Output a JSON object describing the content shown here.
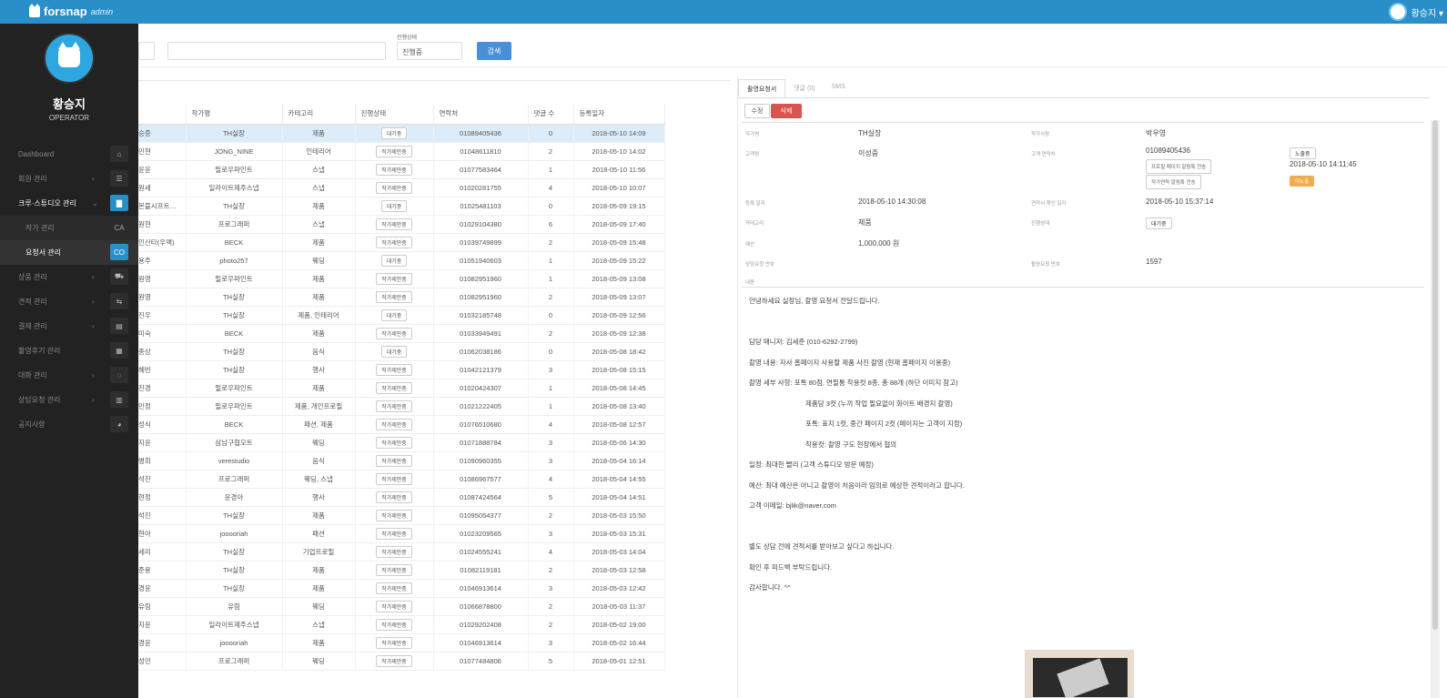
{
  "topbar": {
    "brand": "forsnap",
    "brand_suffix": "admin",
    "user_name": "황승지 ▾"
  },
  "sidebar": {
    "name": "황승지",
    "role": "OPERATOR",
    "menu": [
      {
        "label": "Dashboard",
        "icon": "home-icon",
        "badge": "⌂",
        "chevron": ""
      },
      {
        "label": "회원 관리",
        "icon": "user-icon",
        "badge": "☰",
        "chevron": "›"
      },
      {
        "label": "크루·스튜디오 관리",
        "icon": "book-icon",
        "badge": "▇",
        "chevron": "⌄"
      },
      {
        "label": "작가 관리",
        "icon": "ca-icon",
        "badge": "CA",
        "chevron": ""
      },
      {
        "label": "요청서 관리",
        "icon": "co-icon",
        "badge": "CO",
        "chevron": ""
      },
      {
        "label": "상품 관리",
        "icon": "product-icon",
        "badge": "⛟",
        "chevron": "›"
      },
      {
        "label": "견적 관리",
        "icon": "estimate-icon",
        "badge": "⇆",
        "chevron": "›"
      },
      {
        "label": "결제 관리",
        "icon": "payment-icon",
        "badge": "▤",
        "chevron": "›"
      },
      {
        "label": "촬영후기 관리",
        "icon": "review-icon",
        "badge": "▦",
        "chevron": ""
      },
      {
        "label": "대화 관리",
        "icon": "chat-icon",
        "badge": "◌",
        "chevron": "›"
      },
      {
        "label": "상담요청 관리",
        "icon": "consult-icon",
        "badge": "▥",
        "chevron": "›"
      },
      {
        "label": "공지사항",
        "icon": "notice-icon",
        "badge": "◕",
        "chevron": ""
      }
    ]
  },
  "filters": {
    "status_label": "진행상태",
    "status_value": "진행중",
    "search_button": "검색"
  },
  "table": {
    "headers": [
      "",
      "작가명",
      "카테고리",
      "진행상태",
      "연락처",
      "댓글 수",
      "등록일자"
    ],
    "rows": [
      [
        "승증",
        "TH실장",
        "제품",
        "대기중",
        "01089405436",
        "0",
        "2018-05-10 14:09"
      ],
      [
        "민현",
        "JONG_NINE",
        "인테리어",
        "작가제안중",
        "01048611810",
        "2",
        "2018-05-10 14:02"
      ],
      [
        "윤윤",
        "필로우파인트",
        "스냅",
        "작가제안중",
        "01077583464",
        "1",
        "2018-05-10 11:56"
      ],
      [
        "원세",
        "일라이트제주스냅",
        "스냅",
        "작가제안중",
        "01020281755",
        "4",
        "2018-05-10 10:07"
      ],
      [
        "몬블시프트…",
        "TH실장",
        "제품",
        "대기중",
        "01025481103",
        "0",
        "2018-05-09 19:15"
      ],
      [
        "원현",
        "프로그래퍼",
        "스냅",
        "작가제안중",
        "01029104380",
        "6",
        "2018-05-09 17:40"
      ],
      [
        "인산타(우맥)",
        "BECK",
        "제품",
        "작가제안중",
        "01039749899",
        "2",
        "2018-05-09 15:48"
      ],
      [
        "용주",
        "photo257",
        "웨딩",
        "대기중",
        "01051940603",
        "1",
        "2018-05-09 15:22"
      ],
      [
        "원영",
        "필로우파인트",
        "제품",
        "작가제안중",
        "01082951960",
        "1",
        "2018-05-09 13:08"
      ],
      [
        "원영",
        "TH실장",
        "제품",
        "작가제안중",
        "01082951960",
        "2",
        "2018-05-09 13:07"
      ],
      [
        "진우",
        "TH실장",
        "제품, 인테리어",
        "대기중",
        "01032185748",
        "0",
        "2018-05-09 12:56"
      ],
      [
        "미숙",
        "BECK",
        "제품",
        "작가제안중",
        "01033949491",
        "2",
        "2018-05-09 12:38"
      ],
      [
        "종상",
        "TH실장",
        "음식",
        "대기중",
        "01062038186",
        "0",
        "2018-05-08 18:42"
      ],
      [
        "혜빈",
        "TH실장",
        "행사",
        "작가제안중",
        "01042121379",
        "3",
        "2018-05-08 15:15"
      ],
      [
        "진경",
        "필로우파인트",
        "제품",
        "작가제안중",
        "01020424307",
        "1",
        "2018-05-08 14:45"
      ],
      [
        "민정",
        "필로우파인트",
        "제품, 개인프로필",
        "작가제안중",
        "01021222405",
        "1",
        "2018-05-08 13:40"
      ],
      [
        "성식",
        "BECK",
        "패션, 제품",
        "작가제안중",
        "01076510680",
        "4",
        "2018-05-08 12:57"
      ],
      [
        "지윤",
        "삼남구협모트",
        "웨딩",
        "작가제안중",
        "01071888784",
        "3",
        "2018-05-06 14:30"
      ],
      [
        "병희",
        "verestudio",
        "음식",
        "작가제안중",
        "01090960355",
        "3",
        "2018-05-04 16:14"
      ],
      [
        "석진",
        "프로그래퍼",
        "웨딩, 스냅",
        "작가제안중",
        "01086967577",
        "4",
        "2018-05-04 14:55"
      ],
      [
        "현정",
        "윤경아",
        "행사",
        "작가제안중",
        "01087424564",
        "5",
        "2018-05-04 14:51"
      ],
      [
        "석진",
        "TH실장",
        "제품",
        "작가제안중",
        "01095054377",
        "2",
        "2018-05-03 15:50"
      ],
      [
        "현아",
        "jooooriah",
        "패션",
        "작가제안중",
        "01023209565",
        "3",
        "2018-05-03 15:31"
      ],
      [
        "세리",
        "TH실장",
        "기업프로필",
        "작가제안중",
        "01024555241",
        "4",
        "2018-05-03 14:04"
      ],
      [
        "준용",
        "TH실장",
        "제품",
        "작가제안중",
        "01082119181",
        "2",
        "2018-05-03 12:58"
      ],
      [
        "경윤",
        "TH실장",
        "제품",
        "작가제안중",
        "01046913614",
        "3",
        "2018-05-03 12:42"
      ],
      [
        "유림",
        "유림",
        "웨딩",
        "작가제안중",
        "01066878800",
        "2",
        "2018-05-03 11:37"
      ],
      [
        "지윤",
        "일라이트제주스냅",
        "스냅",
        "작가제안중",
        "01029202408",
        "2",
        "2018-05-02 19:00"
      ],
      [
        "경윤",
        "jooooriah",
        "제품",
        "작가제안중",
        "01046913614",
        "3",
        "2018-05-02 16:44"
      ],
      [
        "성민",
        "프로그래퍼",
        "웨딩",
        "작가제안중",
        "01077484806",
        "5",
        "2018-05-01 12:51"
      ]
    ]
  },
  "detail": {
    "tabs": [
      "촬영요청서",
      "댓글 (0)",
      "SMS"
    ],
    "edit_button": "수정",
    "delete_button": "삭제",
    "fields": {
      "artist_label": "작가명",
      "artist_value": "TH실장",
      "author_label": "작가사람",
      "author_value": "박우영",
      "customer_label": "고객명",
      "customer_value": "이성중",
      "phone_label": "고객 연락처",
      "phone_value": "01089405436",
      "btn_send_profile": "프로필 페이지 알림톡 전송",
      "btn_send_artist": "작가연락 알림톡 전송",
      "exposure_badge": "노출중",
      "exposure_date": "2018-05-10 14:11:45",
      "orange_badge": "미노출",
      "reg_label": "등록 일자",
      "reg_value": "2018-05-10 14:30:08",
      "mod_label": "견적서 확인 일자",
      "mod_value": "2018-05-10 15:37:14",
      "category_label": "카테고리",
      "category_value": "제품",
      "status_label": "진행상태",
      "status_value": "대기중",
      "budget_label": "예산",
      "budget_value": "1,000,000 원",
      "consult_label": "상담요청 번호",
      "request_label": "촬영요청 번호",
      "request_value": "1597",
      "content_label": "내용"
    },
    "message": [
      "안녕하세요 실장님, 촬영 요청서 전달드립니다.",
      "",
      "담당 매니저: 김세준 (010-6292-2799)",
      "촬영 내용: 자사 홈페이지 사용할 제품 사진 촬영 (현재 홈페이지 이용중)",
      "촬영 세부 사항: 포톡 80점, 연필통 착용컷 8종, 총 88개 (하단 이미지 참고)",
      "제품당 3컷 (누끼 작업 필요없이 화이트 배경지 촬영)",
      "포톡: 표지 1컷, 중간 페이지 2컷 (페이지는 고객이 지정)",
      "착용컷: 촬영 구도 현장에서 협의",
      "일정: 최대한 빨리 (고객 스튜디오 방문 예정)",
      "예산: 최대 예산은 아니고 촬영이 처음이라 임의로 예상한 견적이라고 합니다.",
      "고객 이메일: bjlik@naver.com",
      "",
      "별도 상담 전에 견적서를 받아보고 싶다고 하십니다.",
      "확인 후 피드백 부탁드립니다.",
      "감사합니다. ^^"
    ]
  }
}
